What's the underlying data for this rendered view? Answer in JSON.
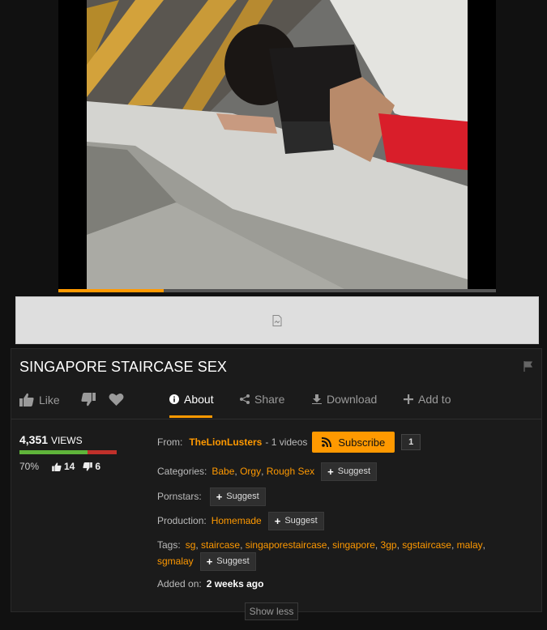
{
  "video": {
    "progress_fraction": 0.24
  },
  "title": "SINGAPORE STAIRCASE SEX",
  "actions": {
    "like": "Like",
    "about": "About",
    "share": "Share",
    "download": "Download",
    "add_to": "Add to"
  },
  "stats": {
    "views_number": "4,351",
    "views_label": "VIEWS",
    "rating_percent": "70%",
    "rating_fraction": 0.7,
    "thumbs_up": "14",
    "thumbs_down": "6"
  },
  "info": {
    "from_label": "From:",
    "channel": "TheLionLusters",
    "videos_count": "- 1 videos",
    "subscribe_label": "Subscribe",
    "subscriber_count": "1",
    "categories_label": "Categories:",
    "categories": [
      "Babe",
      "Orgy",
      "Rough Sex"
    ],
    "pornstars_label": "Pornstars:",
    "production_label": "Production:",
    "production": "Homemade",
    "tags_label": "Tags:",
    "tags_line1": [
      "sg",
      "staircase",
      "singaporestaircase",
      "singapore",
      "3gp",
      "sgstaircase",
      "malay"
    ],
    "tags_line2": [
      "sgmalay"
    ],
    "suggest_label": "Suggest",
    "added_label": "Added on:",
    "added_value": "2 weeks ago"
  },
  "show_less": "Show less",
  "colors": {
    "accent": "#ff9900",
    "rating_good": "#5fb43a",
    "rating_bad": "#c0302a"
  }
}
